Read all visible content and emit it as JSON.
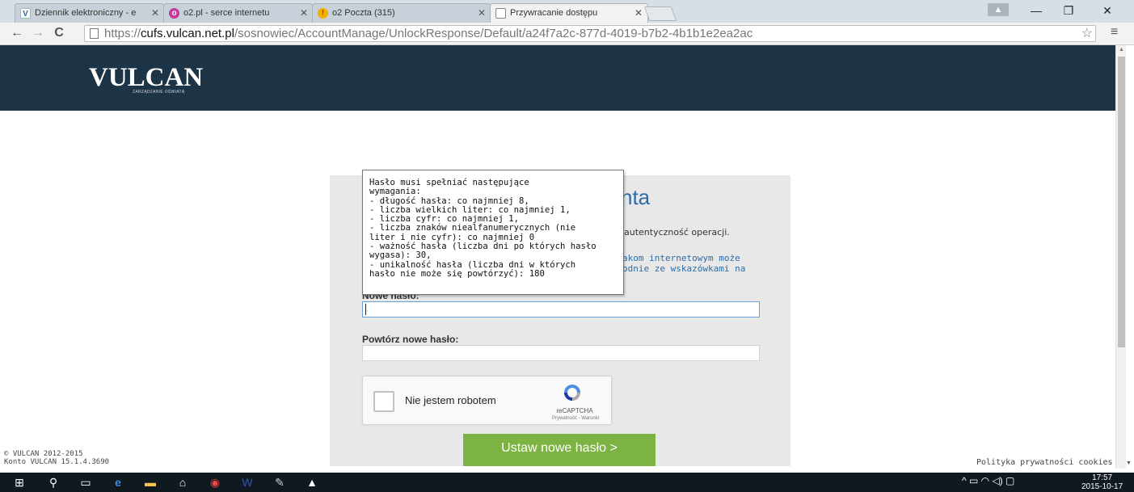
{
  "browser": {
    "tabs": [
      {
        "label": "Dziennik elektroniczny - e",
        "favicon": "V"
      },
      {
        "label": "o2.pl - serce internetu",
        "favicon": "o"
      },
      {
        "label": "o2 Poczta (315)",
        "favicon": "!"
      },
      {
        "label": "Przywracanie dostępu",
        "favicon": ""
      }
    ],
    "url_scheme": "https://",
    "url_host": "cufs.vulcan.net.pl",
    "url_path": "/sosnowiec/AccountManage/UnlockResponse/Default/a24f7a2c-877d-4019-b7b2-4b1b1e2ea2ac"
  },
  "header": {
    "logo": "VULCAN",
    "tagline": "ZARZĄDZANIE OŚWIATĄ"
  },
  "panel": {
    "title_visible": "nta",
    "desc_visible": "autentyczność operacji.",
    "hint_line1": "akom internetowym może",
    "hint_line2": "odnie ze wskazówkami na",
    "new_password_label": "Nowe hasło:",
    "repeat_password_label": "Powtórz nowe hasło:",
    "submit_label": "Ustaw nowe hasło >"
  },
  "recaptcha": {
    "label": "Nie jestem robotem",
    "brand": "reCAPTCHA",
    "links": "Prywatność - Warunki"
  },
  "tooltip": {
    "lines": [
      "Hasło musi spełniać następujące",
      "wymagania:",
      "- długość hasła: co najmniej 8,",
      "- liczba wielkich liter: co najmniej 1,",
      "- liczba cyfr: co najmniej 1,",
      "- liczba znaków niealfanumerycznych (nie",
      "liter i nie cyfr): co najmniej 0",
      "- ważność hasła (liczba dni po których hasło",
      "wygasa): 30,",
      "- unikalność hasła (liczba dni w których",
      "hasło nie może się powtórzyć): 180"
    ]
  },
  "footer": {
    "copyright": "© VULCAN 2012-2015",
    "version": "Konto VULCAN 15.1.4.3690",
    "privacy": "Polityka prywatności cookies"
  },
  "taskbar": {
    "time": "17:57",
    "date": "2015-10-17"
  },
  "colors": {
    "header_bg": "#1d3447",
    "accent_blue": "#2e6ca5",
    "submit_green": "#7cb342",
    "panel_bg": "#e8e8e8"
  }
}
